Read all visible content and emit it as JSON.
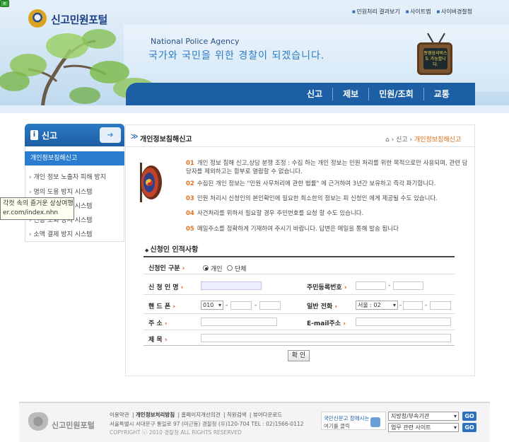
{
  "window": {
    "tab_icon": "e"
  },
  "header": {
    "logo_text": "신고민원포털",
    "top_links": [
      "민원처리 결과보기",
      "사이트맵",
      "사이버경찰청"
    ],
    "agency_en": "National Police Agency",
    "slogan": "국가와 국민을 위한 경찰이 되겠습니다.",
    "tv_text": "동영상서비스도 가능합니다.",
    "main_nav": [
      "신고",
      "제보",
      "민원/조회",
      "교통"
    ]
  },
  "sidebar": {
    "title": "신고",
    "items": [
      {
        "label": "개인정보침해신고",
        "active": true
      },
      {
        "label": "개인 정보 노출자 피해 방지"
      },
      {
        "label": "명의 도용 방지 시스템"
      },
      {
        "label": "개인 정보 보호 시스템"
      },
      {
        "label": "신용 조회 방지 시스템"
      },
      {
        "label": "소액 결제 방지 시스템"
      }
    ]
  },
  "tooltip": {
    "line1": "각컷 속의 즐거운 상상여행",
    "line2": "er.com/index.nhn"
  },
  "content": {
    "page_title": "개인정보침해신고",
    "breadcrumb": {
      "sep": "›",
      "parent": "신고",
      "current": "개인정보침해신고"
    },
    "notes": [
      {
        "num": "01",
        "text": "개인 정보 침해 신고,상담 분쟁 조정 : 수집 하는 개인 정보는 민원 처리를 위한 목적으로만 사용되며, 관련 담당자를 제외하고는 함부로 열람할 수 없습니다."
      },
      {
        "num": "02",
        "text": "수집된 개인 정보는 \"민원 사무처리에 관한 법률\" 에 근거하여 3년간 보유하고 즉각 파기합니다."
      },
      {
        "num": "03",
        "text": "민원 처리시 신청인의 본인확인에 필요한 최소한의 정보는 피 신청인 에게 제공될 수도 있습니다."
      },
      {
        "num": "04",
        "text": "사건처리를 위하서 필요할 경우 주민번호를 요청 할 수도 있습니다."
      },
      {
        "num": "05",
        "text": "메일주소를 정확하게 기재하여 주시기 바랍니다. 답변은 메일을 통해 발송 됩니다"
      }
    ]
  },
  "form": {
    "title": "신청인 인적사항",
    "applicant_type_label": "신청인 구분",
    "option_individual": "개인",
    "option_group": "단체",
    "name_label": "신 청 인 명",
    "rrn_label": "주민등록번호",
    "mobile_label": "핸 드 폰",
    "mobile_prefix": "010",
    "phone_label": "일반 전화",
    "phone_prefix": "서울 : 02",
    "address_label": "주 소",
    "email_label": "E-mail주소",
    "subject_label": "제 목",
    "dash": "-",
    "confirm_label": "확 인"
  },
  "footer": {
    "logo_text": "신고민원포털",
    "links": [
      "이용약관",
      "개인정보처리방침",
      "홈페이지개선의견",
      "직원검색",
      "뷰어다운로드"
    ],
    "address": "서울특별시 서대문구 통일로 97 (미근동) 경찰청 (우)120-704 TEL : 02)1566-0112",
    "copyright": "COPYRIGHT ⓒ 2010 경찰청 ALL RIGHTS RESERVED",
    "banner_line1": "국민신문고 장애시는",
    "banner_line2": "여기를 클릭",
    "select1": "지방청/부속기관",
    "select2": "업무 관련 사이트",
    "go_label": "GO"
  },
  "colors": {
    "nav_blue": "#1c5fa5",
    "accent_orange": "#e3711d",
    "active_blue": "#2b7ecf"
  }
}
